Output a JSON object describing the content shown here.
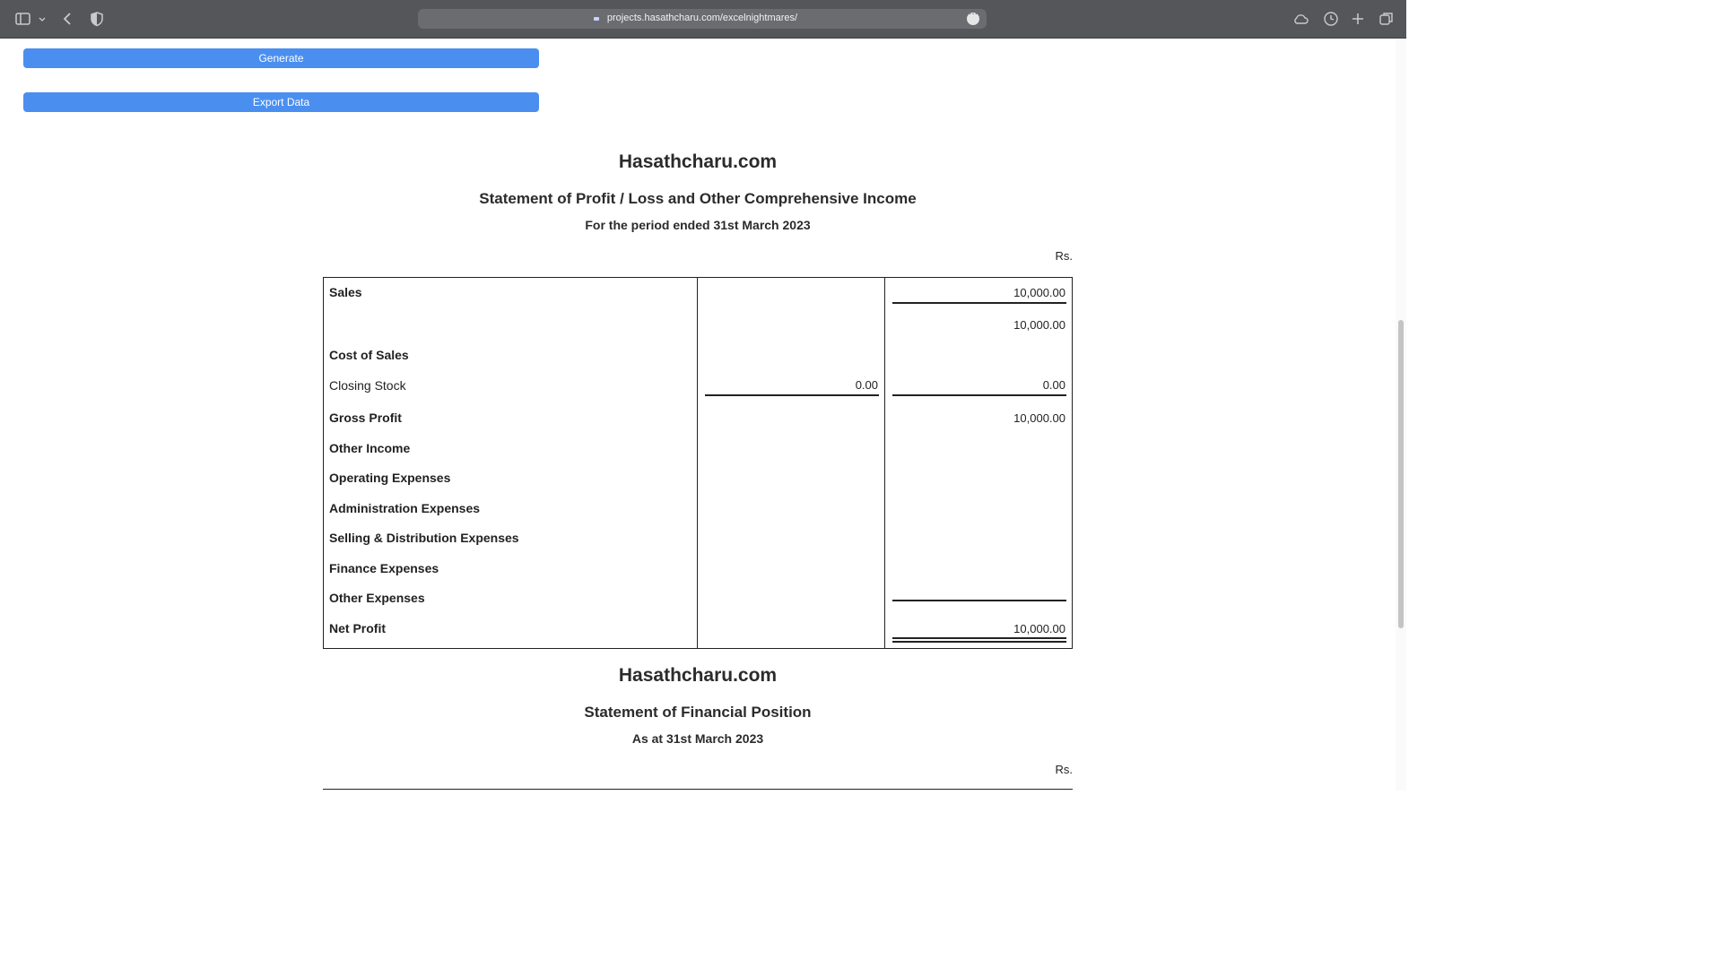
{
  "browser": {
    "url": "projects.hasathcharu.com/excelnightmares/"
  },
  "actions": {
    "generate_label": "Generate",
    "export_label": "Export Data"
  },
  "pl": {
    "site": "Hasathcharu.com",
    "title": "Statement of Profit / Loss and Other Comprehensive Income",
    "period": "For the period ended 31st March 2023",
    "currency": "Rs.",
    "rows": {
      "sales_label": "Sales",
      "sales_c3": "10,000.00",
      "sales_total_c3": "10,000.00",
      "cost_label": "Cost of Sales",
      "closing_stock_label": "Closing Stock",
      "closing_stock_c2": "0.00",
      "closing_stock_c3": "0.00",
      "gross_profit_label": "Gross Profit",
      "gross_profit_c3": "10,000.00",
      "other_income_label": "Other Income",
      "operating_label": "Operating Expenses",
      "admin_label": "Administration Expenses",
      "selling_label": "Selling & Distribution Expenses",
      "finance_label": "Finance Expenses",
      "other_exp_label": "Other Expenses",
      "net_profit_label": "Net Profit",
      "net_profit_c3": "10,000.00"
    }
  },
  "fp": {
    "site": "Hasathcharu.com",
    "title": "Statement of Financial Position",
    "as_at": "As at 31st March 2023",
    "currency": "Rs."
  }
}
